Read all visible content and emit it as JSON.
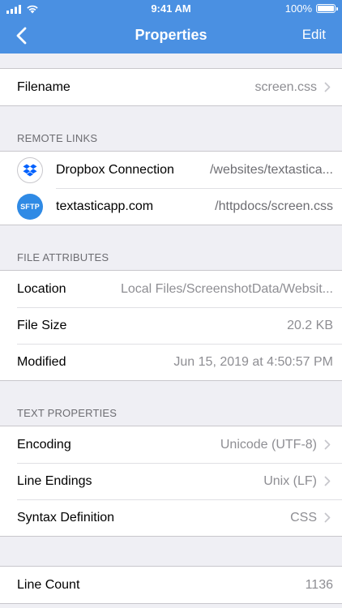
{
  "status": {
    "time": "9:41 AM",
    "battery": "100%"
  },
  "nav": {
    "title": "Properties",
    "edit_label": "Edit"
  },
  "filename": {
    "label": "Filename",
    "value": "screen.css"
  },
  "remote_links": {
    "header": "REMOTE LINKS",
    "items": [
      {
        "icon": "dropbox-icon",
        "label": "Dropbox Connection",
        "value": "/websites/textastica..."
      },
      {
        "icon": "sftp-icon",
        "icon_text": "SFTP",
        "label": "textasticapp.com",
        "value": "/httpdocs/screen.css"
      }
    ]
  },
  "file_attributes": {
    "header": "FILE ATTRIBUTES",
    "items": [
      {
        "label": "Location",
        "value": "Local Files/ScreenshotData/Websit..."
      },
      {
        "label": "File Size",
        "value": "20.2 KB"
      },
      {
        "label": "Modified",
        "value": "Jun 15, 2019 at 4:50:57 PM"
      }
    ]
  },
  "text_properties": {
    "header": "TEXT PROPERTIES",
    "items": [
      {
        "label": "Encoding",
        "value": "Unicode (UTF-8)"
      },
      {
        "label": "Line Endings",
        "value": "Unix (LF)"
      },
      {
        "label": "Syntax Definition",
        "value": "CSS"
      }
    ]
  },
  "stats": {
    "items": [
      {
        "label": "Line Count",
        "value": "1136"
      }
    ]
  },
  "colors": {
    "nav_background": "#4a90e2",
    "page_background": "#efeff4",
    "secondary_text": "#8e8e93",
    "sftp_badge": "#2f8ae5",
    "dropbox_blue": "#0061fe"
  }
}
